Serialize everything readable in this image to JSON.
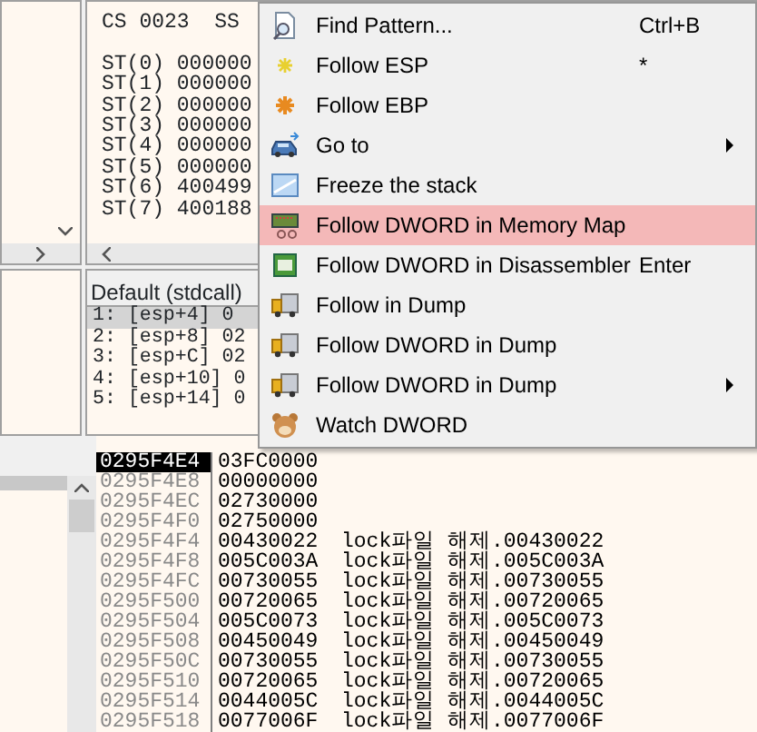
{
  "registers": {
    "segment_lines": [
      "CS 0023  SS"
    ],
    "fpu_lines": [
      "ST(0) 000000",
      "ST(1) 000000",
      "ST(2) 000000",
      "ST(3) 000000",
      "ST(4) 000000",
      "ST(5) 000000",
      "ST(6) 400499",
      "ST(7) 400188"
    ]
  },
  "call_stack": {
    "title": "Default (stdcall)",
    "rows": [
      {
        "text": "1: [esp+4] 0",
        "selected": true
      },
      {
        "text": "2: [esp+8] 02",
        "selected": false
      },
      {
        "text": "3: [esp+C] 02",
        "selected": false
      },
      {
        "text": "4: [esp+10] 0",
        "selected": false
      },
      {
        "text": "5: [esp+14] 0",
        "selected": false
      }
    ]
  },
  "dump": {
    "rows": [
      {
        "address": "0295F4E4",
        "value": "03FC0000",
        "selected": true
      },
      {
        "address": "0295F4E8",
        "value": "00000000",
        "selected": false
      },
      {
        "address": "0295F4EC",
        "value": "02730000",
        "selected": false
      },
      {
        "address": "0295F4F0",
        "value": "02750000",
        "selected": false
      },
      {
        "address": "0295F4F4",
        "value": "00430022",
        "comment": "lock파일 해제.00430022",
        "selected": false
      },
      {
        "address": "0295F4F8",
        "value": "005C003A",
        "comment": "lock파일 해제.005C003A",
        "selected": false
      },
      {
        "address": "0295F4FC",
        "value": "00730055",
        "comment": "lock파일 해제.00730055",
        "selected": false
      },
      {
        "address": "0295F500",
        "value": "00720065",
        "comment": "lock파일 해제.00720065",
        "selected": false
      },
      {
        "address": "0295F504",
        "value": "005C0073",
        "comment": "lock파일 해제.005C0073",
        "selected": false
      },
      {
        "address": "0295F508",
        "value": "00450049",
        "comment": "lock파일 해제.00450049",
        "selected": false
      },
      {
        "address": "0295F50C",
        "value": "00730055",
        "comment": "lock파일 해제.00730055",
        "selected": false
      },
      {
        "address": "0295F510",
        "value": "00720065",
        "comment": "lock파일 해제.00720065",
        "selected": false
      },
      {
        "address": "0295F514",
        "value": "0044005C",
        "comment": "lock파일 해제.0044005C",
        "selected": false
      },
      {
        "address": "0295F518",
        "value": "0077006F",
        "comment": "lock파일 해제.0077006F",
        "selected": false
      }
    ]
  },
  "context_menu": {
    "items": [
      {
        "label": "Find Pattern...",
        "shortcut": "Ctrl+B",
        "submenu": false,
        "highlighted": false
      },
      {
        "label": "Follow ESP",
        "shortcut": "*",
        "submenu": false,
        "highlighted": false
      },
      {
        "label": "Follow EBP",
        "submenu": false,
        "highlighted": false
      },
      {
        "label": "Go to",
        "submenu": true,
        "highlighted": false
      },
      {
        "label": "Freeze the stack",
        "submenu": false,
        "highlighted": false
      },
      {
        "label": "Follow DWORD in Memory Map",
        "submenu": false,
        "highlighted": true
      },
      {
        "label": "Follow DWORD in Disassembler",
        "shortcut": "Enter",
        "submenu": false,
        "highlighted": false
      },
      {
        "label": "Follow in Dump",
        "submenu": false,
        "highlighted": false
      },
      {
        "label": "Follow DWORD in Dump",
        "submenu": false,
        "highlighted": false
      },
      {
        "label": "Follow DWORD in Dump",
        "submenu": true,
        "highlighted": false
      },
      {
        "label": "Watch DWORD",
        "submenu": false,
        "highlighted": false
      }
    ]
  }
}
